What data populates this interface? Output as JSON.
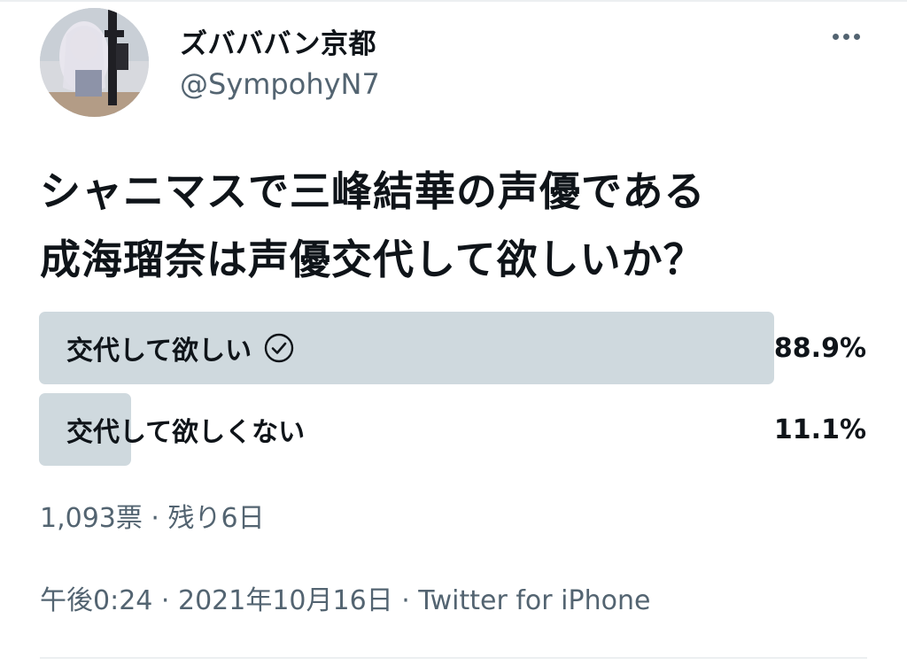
{
  "author": {
    "display_name": "ズバババン京都",
    "handle": "@SympohyN7",
    "avatar_icon": "anime-avatar"
  },
  "more_icon": "more-horizontal-icon",
  "tweet": {
    "lines": [
      "シャニマスで三峰結華の声優である",
      "成海瑠奈は声優交代して欲しいか？"
    ]
  },
  "poll": {
    "options": [
      {
        "label": "交代して欲しい",
        "percent": "88.9%",
        "share": 88.9,
        "winner": true
      },
      {
        "label": "交代して欲しくない",
        "percent": "11.1%",
        "share": 11.1,
        "winner": false
      }
    ],
    "summary": "1,093票 · 残り6日",
    "winner_color": "#cfd9de",
    "other_color": "#cfd9de"
  },
  "meta": {
    "timestamp": "午後0:24 · 2021年10月16日 · Twitter for iPhone"
  }
}
